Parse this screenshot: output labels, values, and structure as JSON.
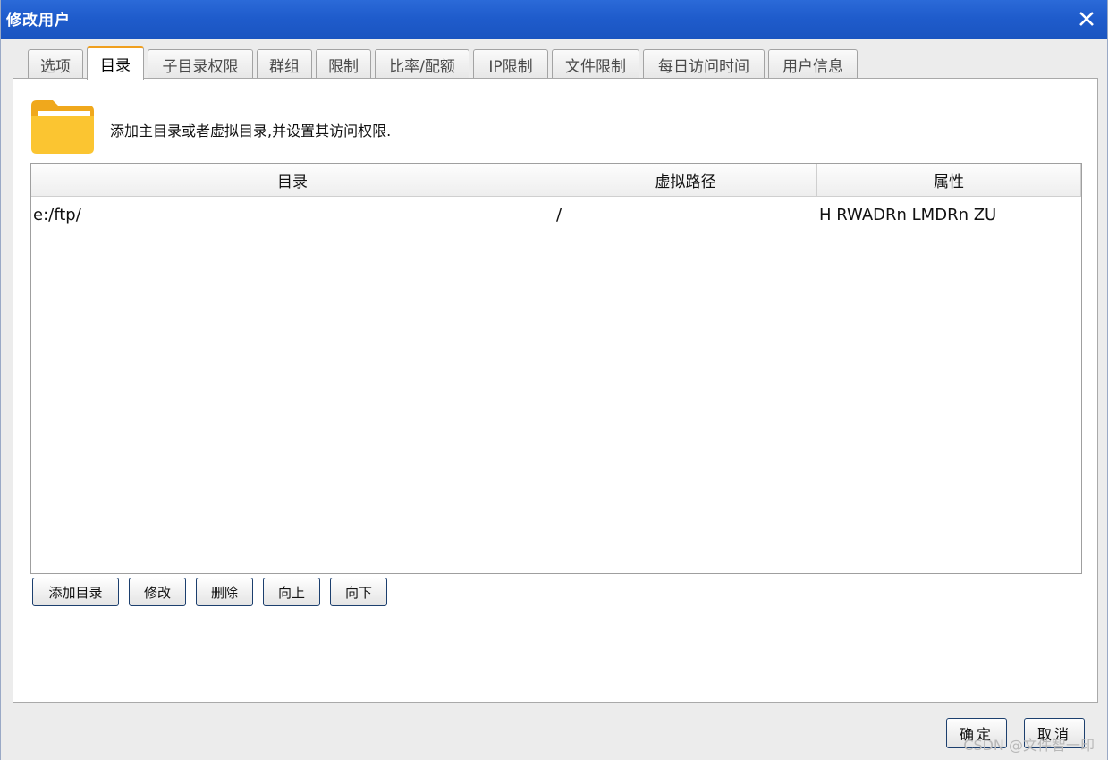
{
  "window": {
    "title": "修改用户"
  },
  "tabs": [
    {
      "label": "选项"
    },
    {
      "label": "目录"
    },
    {
      "label": "子目录权限"
    },
    {
      "label": "群组"
    },
    {
      "label": "限制"
    },
    {
      "label": "比率/配额"
    },
    {
      "label": "IP限制"
    },
    {
      "label": "文件限制"
    },
    {
      "label": "每日访问时间"
    },
    {
      "label": "用户信息"
    }
  ],
  "active_tab": "目录",
  "description": "添加主目录或者虚拟目录,并设置其访问权限.",
  "table": {
    "columns": [
      "目录",
      "虚拟路径",
      "属性"
    ],
    "rows": [
      [
        "e:/ftp/",
        "/",
        "H RWADRn LMDRn ZU"
      ]
    ]
  },
  "actions": {
    "add_dir": "添加目录",
    "modify": "修改",
    "delete": "删除",
    "move_up": "向上",
    "move_down": "向下"
  },
  "footer": {
    "ok": "确定",
    "cancel": "取消"
  },
  "watermark": "CSDN @文件智一印",
  "colors": {
    "titlebar": "#1f5ccc",
    "active_tab_accent": "#f0a020",
    "folder": "#fbc531"
  }
}
